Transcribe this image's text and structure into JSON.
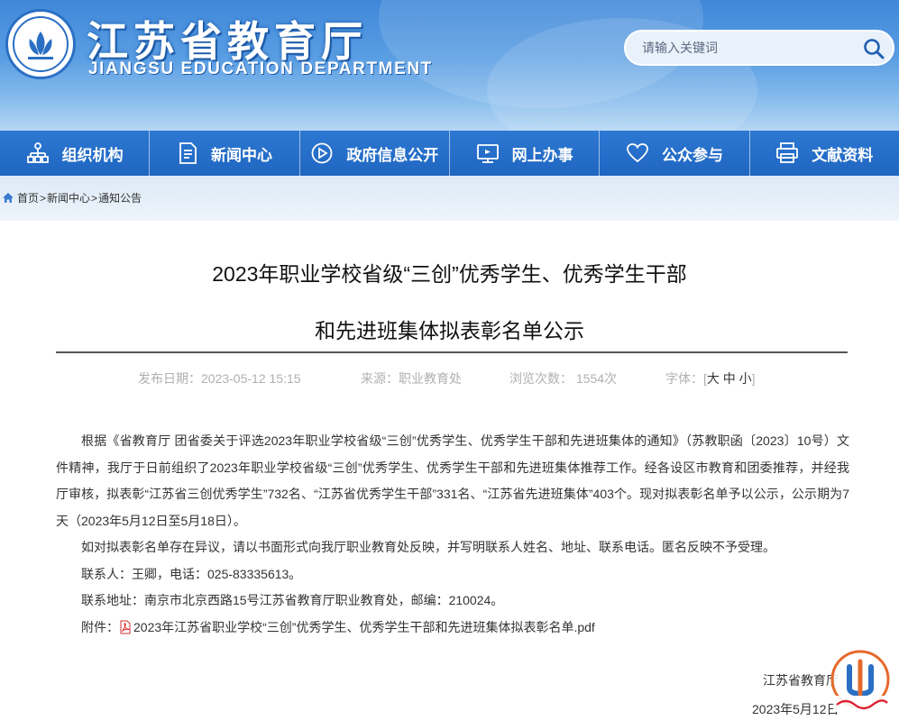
{
  "header": {
    "title": "江苏省教育厅",
    "subtitle": "JIANGSU EDUCATION DEPARTMENT",
    "search_placeholder": "请输入关键词"
  },
  "nav": {
    "items": [
      {
        "label": "组织机构",
        "icon": "org-chart-icon"
      },
      {
        "label": "新闻中心",
        "icon": "document-icon"
      },
      {
        "label": "政府信息公开",
        "icon": "compass-icon"
      },
      {
        "label": "网上办事",
        "icon": "monitor-icon"
      },
      {
        "label": "公众参与",
        "icon": "heart-icon"
      },
      {
        "label": "文献资料",
        "icon": "printer-icon"
      }
    ]
  },
  "breadcrumb": {
    "home": "首页",
    "news": "新闻中心",
    "current": "通知公告"
  },
  "article": {
    "title_line1": "2023年职业学校省级“三创”优秀学生、优秀学生干部",
    "title_line2": "和先进班集体拟表彰名单公示",
    "meta": {
      "date": "发布日期：2023-05-12 15:15",
      "source": "来源：职业教育处",
      "views": "浏览次数： 1554次",
      "font_label": "字体：",
      "font_large": "大",
      "font_medium": "中",
      "font_small": "小"
    },
    "paragraph1": "根据《省教育厅 团省委关于评选2023年职业学校省级“三创”优秀学生、优秀学生干部和先进班集体的通知》（苏教职函〔2023〕10号）文件精神，我厅于日前组织了2023年职业学校省级“三创”优秀学生、优秀学生干部和先进班集体推荐工作。经各设区市教育和团委推荐，并经我厅审核，拟表彰“江苏省三创优秀学生”732名、“江苏省优秀学生干部”331名、“江苏省先进班集体”403个。现对拟表彰名单予以公示，公示期为7天（2023年5月12日至5月18日）。",
    "paragraph2": "如对拟表彰名单存在异议，请以书面形式向我厅职业教育处反映，并写明联系人姓名、地址、联系电话。匿名反映不予受理。",
    "contact": "联系人：王卿，电话：025-83335613。",
    "address": "联系地址：南京市北京西路15号江苏省教育厅职业教育处，邮编：210024。",
    "attachment_label": "附件：",
    "attachment_link": "2023年江苏省职业学校“三创”优秀学生、优秀学生干部和先进班集体拟表彰名单.pdf",
    "signature": "江苏省教育厅",
    "sign_date": "2023年5月12日"
  },
  "colors": {
    "nav_bg": "#1f66c1",
    "header_top": "#3f87d9",
    "crumb_bg": "#dce9f6"
  }
}
